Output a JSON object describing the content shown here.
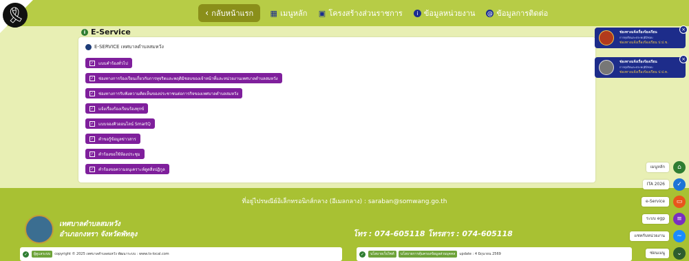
{
  "nav": {
    "back_label": "กลับหน้าแรก",
    "items": [
      {
        "label": "เมนูหลัก"
      },
      {
        "label": "โครงสร้างส่วนราชการ"
      },
      {
        "label": "ข้อมูลหน่วยงาน"
      },
      {
        "label": "ข้อมูลการติดต่อ"
      }
    ]
  },
  "main": {
    "section_title": "E-Service",
    "card_heading": "E-SERVICE เทศบาลตำบลสมหวัง",
    "buttons": [
      "แบบคำร้องทั่วไป",
      "ช่องทางการร้องเรียนเกี่ยวกับการทุจริตและพฤติมิชอบของเจ้าหน้าที่และหน่วยงานเทศบาลตำบลสมหวัง",
      "ช่องทางการรับฟังความคิดเห็นของประชาชนต่อการกิจของเทศบาลตำบลสมหวัง",
      "แจ้งเรื่องร้องเรียนร้องทุกข์",
      "แบบจองคิวออนไลน์ SmartQ",
      "คำขอรู้ข้อมูลข่าวสาร",
      "คำร้องขอใช้ห้องประชุม",
      "คำร้องขอความอนุเคราะห์ดูดสิ่งปฏิกูล"
    ]
  },
  "notifications": [
    {
      "title": "ช่องทางแจ้งเรื่องร้องเรียน",
      "subtitle": "การทุจริตและประพฤติมิชอบ",
      "source": "ช่องทางแจ้งเรื่องร้องเรียน ป.ป.ช."
    },
    {
      "title": "ช่องทางแจ้งเรื่องร้องเรียน",
      "subtitle": "การทุจริตและประพฤติมิชอบ",
      "source": "ช่องทางแจ้งเรื่องร้องเรียน ป.ป.ท."
    }
  ],
  "sidebar": [
    {
      "label": "เมนูหลัก",
      "color": "#2f7d32",
      "icon": "home-icon"
    },
    {
      "label": "ITA 2026",
      "color": "#1e74d6",
      "icon": "check-badge-icon"
    },
    {
      "label": "e-Service",
      "color": "#e8551c",
      "icon": "chat-icon"
    },
    {
      "label": "ระบบ egp",
      "color": "#7a2fbf",
      "icon": "message-icon"
    },
    {
      "label": "แชทกับหน่วยงาน",
      "color": "#1a8cff",
      "icon": "messenger-icon"
    },
    {
      "label": "ซ่อนเมนู",
      "color": "#2e5d2e",
      "icon": "chevron-down-icon"
    }
  ],
  "footer": {
    "email_line": "ที่อยู่ไปรษณีย์อิเล็กทรอนิกส์กลาง (อีเมลกลาง) : saraban@somwang.go.th",
    "org_name": "เทศบาลตำบลสมหวัง",
    "org_location": "อำเภอกงหรา จังหวัดพัทลุง",
    "tel_line": "โทร : 074-605118 โทรสาร : 074-605118",
    "left_tag": "ผู้ดูแลระบบ",
    "copyright": "copyright © 2025 เทศบาลตำบลสมหวัง พัฒนาระบบ : www.ts-local.com",
    "right_tag1": "นโยบายเว็บไซต์",
    "right_tag2": "นโยบายการคุ้มครองข้อมูลส่วนบุคคล",
    "update": "update : 4 มิถุนายน 2569"
  }
}
